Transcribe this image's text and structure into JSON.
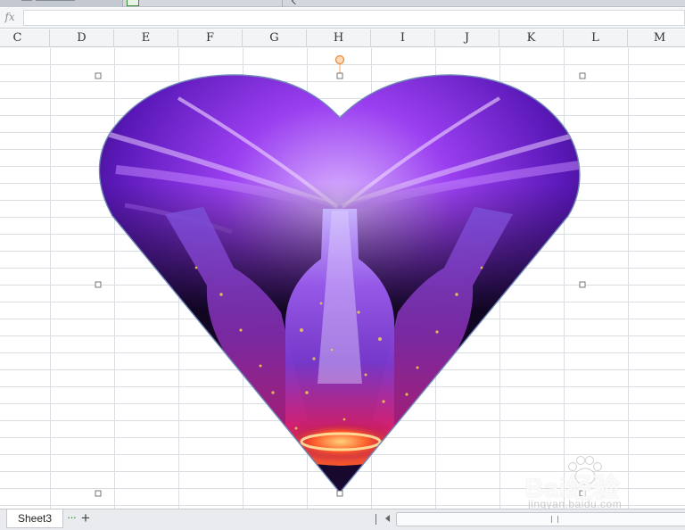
{
  "formula_bar": {
    "fx_label": "fx",
    "value": ""
  },
  "columns": [
    "C",
    "D",
    "E",
    "F",
    "G",
    "H",
    "I",
    "J",
    "K",
    "L",
    "M"
  ],
  "shape": {
    "kind": "heart",
    "fill": "photo of glowing glass bottles with purple light"
  },
  "sheets": {
    "active": "Sheet3",
    "more_indicator": "···",
    "add_label": "+"
  },
  "watermark": {
    "brand": "Bai经验",
    "url": "jingyan.baidu.com"
  },
  "colors": {
    "handle_rotate": "#f4a460",
    "shape_border": "#6f86b8",
    "sheet_more": "#2f8a2f"
  }
}
